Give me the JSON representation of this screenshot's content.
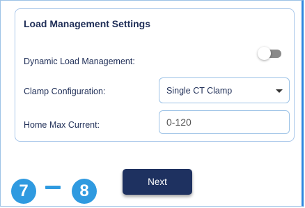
{
  "card": {
    "title": "Load Management Settings",
    "dynamic_label": "Dynamic Load Management:",
    "dynamic_enabled": false,
    "clamp_label": "Clamp Configuration:",
    "clamp_value": "Single CT Clamp",
    "current_label": "Home Max Current:",
    "current_placeholder": "0-120"
  },
  "next_label": "Next",
  "steps": {
    "from": "7",
    "to": "8"
  },
  "colors": {
    "navy": "#1e3160",
    "step_blue": "#2f9ae0",
    "border_blue": "#9cc2e6"
  }
}
